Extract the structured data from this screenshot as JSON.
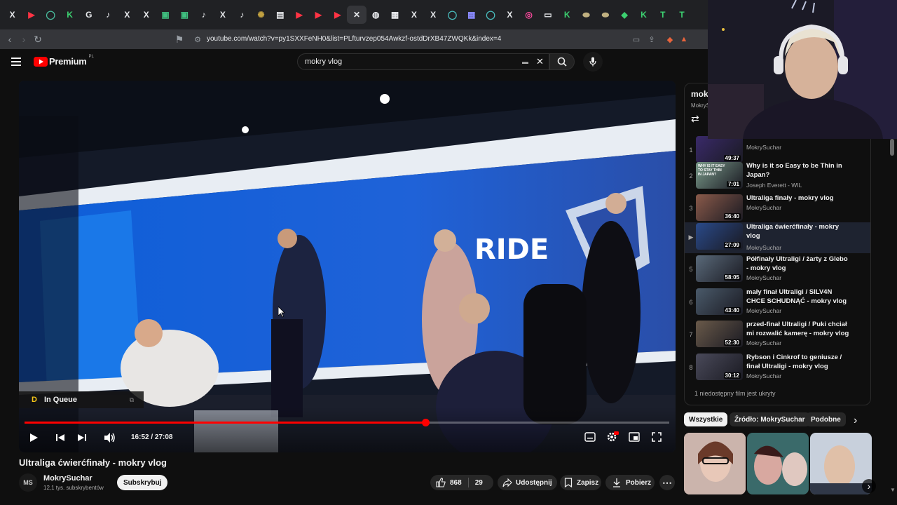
{
  "browser": {
    "url": "youtube.com/watch?v=py1SXXFeNH0&list=PLfturvzep054Awkzf-ostdDrXB47ZWQKk&index=4",
    "tabs": [
      "X",
      "▶",
      "◯",
      "K",
      "G",
      "♪",
      "X",
      "X",
      "▣",
      "▣",
      "♪",
      "X",
      "♪",
      "✺",
      "▤",
      "▶",
      "▶",
      "▶",
      "✕",
      "◍",
      "▦",
      "X",
      "X",
      "◯",
      "▦",
      "◯",
      "X",
      "◎",
      "▭",
      "K",
      "⬬",
      "⬬",
      "◆",
      "K",
      "T",
      "T"
    ]
  },
  "header": {
    "logo": "Premium",
    "logo_region": "PL",
    "search_value": "mokry vlog"
  },
  "player": {
    "queue_label": "In Queue",
    "time": "16:52 / 27:08",
    "progress": 0.622,
    "scene_brand": "RIDE"
  },
  "video_info": {
    "title": "Ultraliga ćwierćfinały - mokry vlog",
    "channel": "MokrySuchar",
    "channel_initials": "MS",
    "subscribers": "12,1 tys. subskrybentów",
    "subscribe_label": "Subskrybuj",
    "likes": "868",
    "dislikes": "29",
    "share_label": "Udostępnij",
    "save_label": "Zapisz",
    "download_label": "Pobierz"
  },
  "playlist": {
    "title": "mok",
    "owner": "MokryS",
    "hidden_note": "1 niedostępny film jest ukryty",
    "items": [
      {
        "index": "1",
        "title": "",
        "channel": "MokrySuchar",
        "duration": "49:37",
        "color": "#3a2a6a"
      },
      {
        "index": "2",
        "title": "Why is it so Easy to be Thin in Japan?",
        "channel": "Joseph Everett - WIL",
        "duration": "7:01",
        "color": "#7a9a8a",
        "thumb_text": "WHY IS IT EASY TO STAY THIN IN JAPAN?"
      },
      {
        "index": "3",
        "title": "Ultraliga finały - mokry vlog",
        "channel": "MokrySuchar",
        "duration": "36:40",
        "color": "#8a5a4a"
      },
      {
        "index": "▶",
        "title": "Ultraliga ćwierćfinały - mokry vlog",
        "channel": "MokrySuchar",
        "duration": "27:09",
        "color": "#2a4a8a"
      },
      {
        "index": "5",
        "title": "Półfinały Ultraligi / żarty z Glebo - mokry vlog",
        "channel": "MokrySuchar",
        "duration": "58:05",
        "color": "#5a6a7a"
      },
      {
        "index": "6",
        "title": "mały finał Ultraligi / SILV4N CHCE SCHUDNĄĆ - mokry vlog",
        "channel": "MokrySuchar",
        "duration": "43:40",
        "color": "#4a5a6a"
      },
      {
        "index": "7",
        "title": "przed-finał Ultraligi / Puki chciał mi rozwalić kamerę - mokry vlog",
        "channel": "MokrySuchar",
        "duration": "52:30",
        "color": "#6a5a4a"
      },
      {
        "index": "8",
        "title": "Rybson i Cinkrof to geniusze / finał Ultraligi - mokry vlog",
        "channel": "MokrySuchar",
        "duration": "30:12",
        "color": "#4a4a5a"
      }
    ]
  },
  "chips": [
    "Wszystkie",
    "Źródło: MokrySuchar",
    "Podobne"
  ],
  "colors": {
    "accent": "#ff0000",
    "bg": "#0f0f0f"
  }
}
